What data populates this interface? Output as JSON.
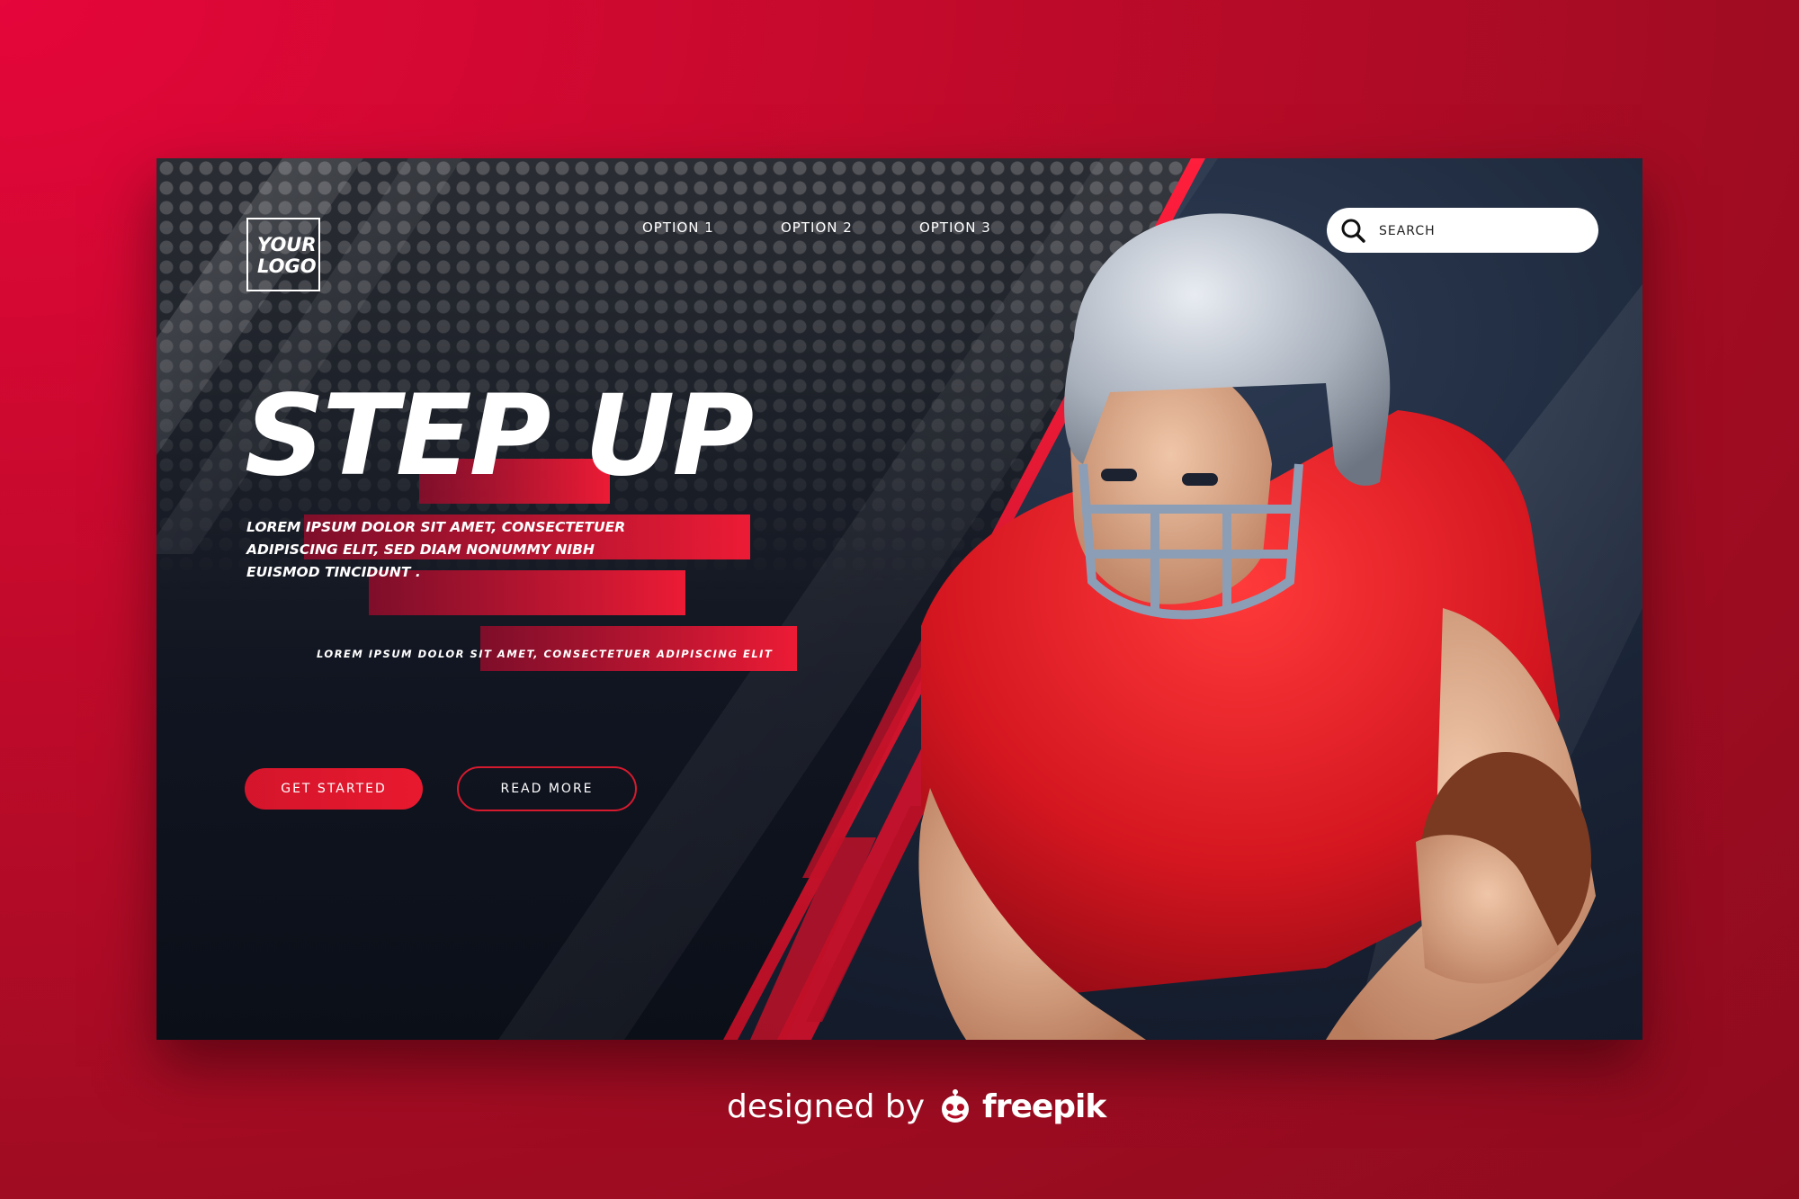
{
  "header": {
    "logo_text": "YOUR LOGO",
    "nav": [
      {
        "label": "OPTION 1"
      },
      {
        "label": "OPTION 2"
      },
      {
        "label": "OPTION 3"
      }
    ],
    "search": {
      "placeholder": "SEARCH",
      "icon": "search-icon"
    }
  },
  "hero": {
    "headline": "STEP UP",
    "body": "LOREM IPSUM DOLOR SIT AMET, CONSECTETUER ADIPISCING ELIT, SED DIAM NONUMMY NIBH EUISMOD TINCIDUNT .",
    "tagline": "LOREM IPSUM DOLOR SIT AMET, CONSECTETUER ADIPISCING ELIT",
    "primary_button": "GET STARTED",
    "secondary_button": "READ MORE"
  },
  "footer_credit": {
    "prefix": "designed by",
    "brand": "freepik"
  },
  "colors": {
    "accent": "#e8192f",
    "background": "#c40a2c",
    "card": "#0d121c",
    "text": "#ffffff"
  }
}
